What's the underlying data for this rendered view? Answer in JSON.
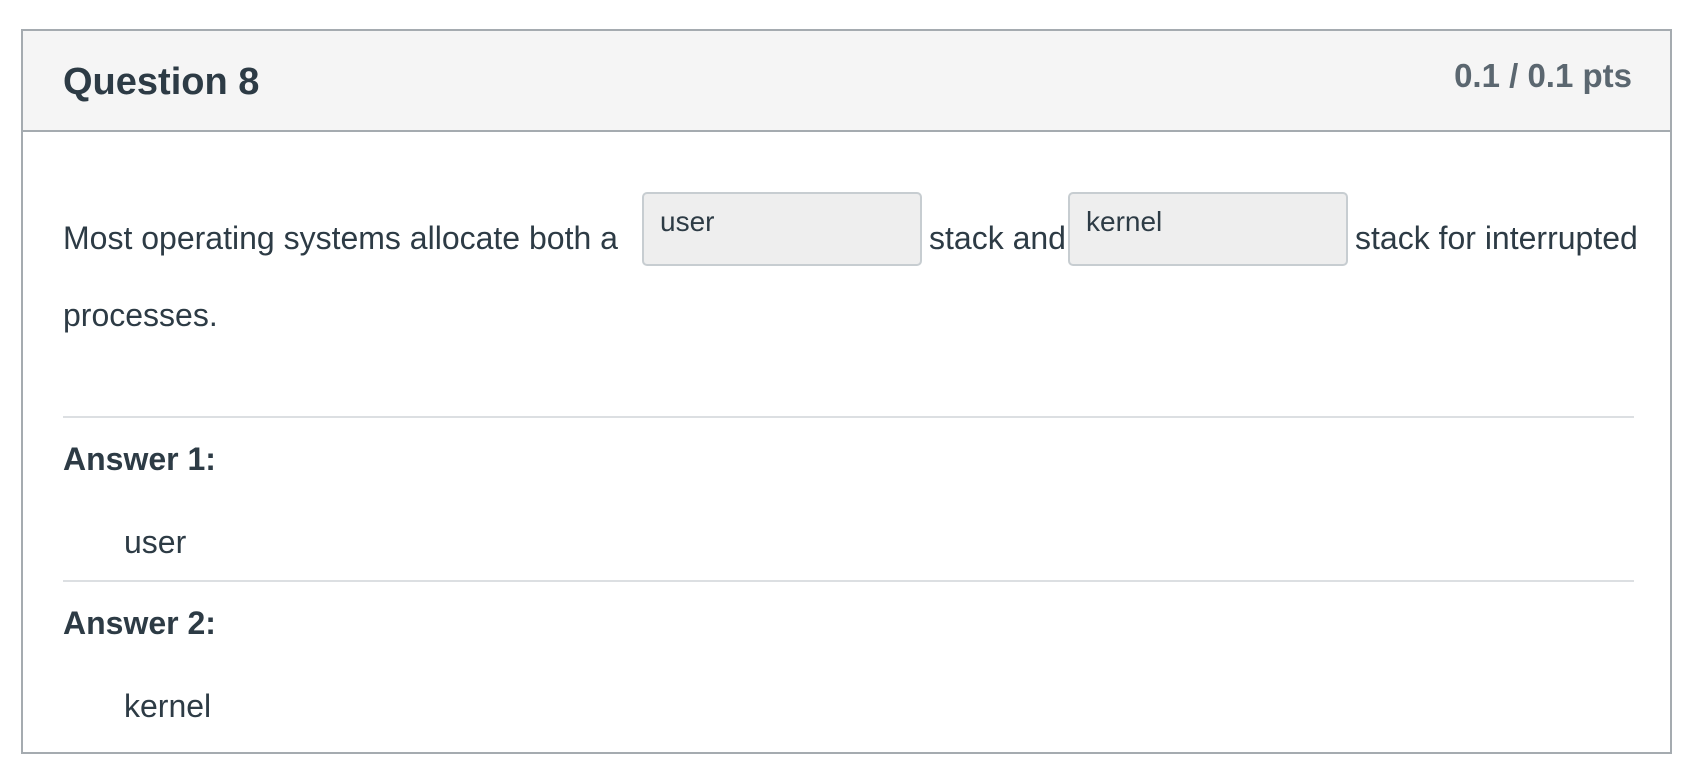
{
  "question": {
    "title": "Question 8",
    "points": "0.1 / 0.1 pts",
    "text_before_blank_1": "Most operating systems allocate both a",
    "blank_1_value": "user",
    "text_between_blanks": "stack and",
    "blank_2_value": "kernel",
    "text_after_blank_2": "stack for interrupted",
    "text_line_2": "processes."
  },
  "answers": [
    {
      "label": "Answer 1:",
      "value": "user"
    },
    {
      "label": "Answer 2:",
      "value": "kernel"
    }
  ]
}
